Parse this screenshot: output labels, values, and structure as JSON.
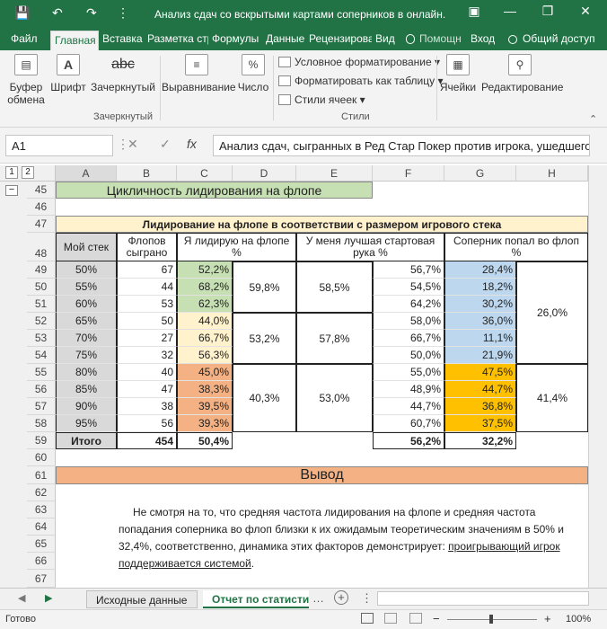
{
  "window": {
    "title": "Анализ сдач со вскрытыми картами соперников в онлайн...",
    "min": "—",
    "restore": "❐",
    "close": "✕",
    "qa_save": "💾",
    "qa_undo": "↶",
    "qa_redo": "↷",
    "qa_more": "⋮",
    "ribbon_options": "▣"
  },
  "tabs": [
    "Файл",
    "Главная",
    "Вставка",
    "Разметка стр",
    "Формулы",
    "Данные",
    "Рецензирова",
    "Вид",
    "Помощн",
    "Вход",
    "Общий доступ"
  ],
  "ribbon": {
    "clipboard": "Буфер обмена",
    "font": "Шрифт",
    "strike": "abc",
    "strike_label": "Зачеркнутый",
    "alignment": "Выравнивание",
    "number": "Число",
    "cond_format": "Условное форматирование",
    "format_table": "Форматировать как таблицу",
    "cell_styles": "Стили ячеек",
    "cells": "Ячейки",
    "editing": "Редактирование",
    "group_strike": "Зачеркнутый",
    "group_styles": "Стили"
  },
  "formula_bar": {
    "name_box": "A1",
    "fx": "fx",
    "formula": "Анализ сдач, сыгранных в Ред Стар Покер против игрока, ушедшего"
  },
  "columns": [
    "A",
    "B",
    "C",
    "D",
    "E",
    "F",
    "G",
    "H"
  ],
  "outline_levels": [
    "1",
    "2"
  ],
  "rows": [
    "45",
    "46",
    "47",
    "48",
    "49",
    "50",
    "51",
    "52",
    "53",
    "54",
    "55",
    "56",
    "57",
    "58",
    "59",
    "60",
    "61",
    "62",
    "63",
    "64",
    "65",
    "66",
    "67"
  ],
  "sheet": {
    "section_title": "Цикличность лидирования на флопе",
    "table_title": "Лидирование на флопе в соответствии с размером игрового стека",
    "headers": [
      "Мой стек",
      "Флопов сыграно",
      "Я лидирую на флопе %",
      "У меня лучшая стартовая рука %",
      "Соперник попал во флоп %"
    ],
    "data_rows": [
      [
        "50%",
        "67",
        "52,2%",
        "56,7%",
        "28,4%"
      ],
      [
        "55%",
        "44",
        "68,2%",
        "54,5%",
        "18,2%"
      ],
      [
        "60%",
        "53",
        "62,3%",
        "64,2%",
        "30,2%"
      ],
      [
        "65%",
        "50",
        "44,0%",
        "58,0%",
        "36,0%"
      ],
      [
        "70%",
        "27",
        "66,7%",
        "66,7%",
        "11,1%"
      ],
      [
        "75%",
        "32",
        "56,3%",
        "50,0%",
        "21,9%"
      ],
      [
        "80%",
        "40",
        "45,0%",
        "55,0%",
        "47,5%"
      ],
      [
        "85%",
        "47",
        "38,3%",
        "48,9%",
        "44,7%"
      ],
      [
        "90%",
        "38",
        "39,5%",
        "44,7%",
        "36,8%"
      ],
      [
        "95%",
        "56",
        "39,3%",
        "60,7%",
        "37,5%"
      ]
    ],
    "group_lead": [
      "59,8%",
      "53,2%",
      "40,3%"
    ],
    "group_best": [
      "58,5%",
      "57,8%",
      "53,0%"
    ],
    "group_opp": [
      "26,0%",
      "41,4%"
    ],
    "total_label": "Итого",
    "total_flops": "454",
    "total_lead": "50,4%",
    "total_best": "56,2%",
    "total_opp": "32,2%",
    "conclusion_title": "Вывод",
    "conclusion_l1": "Не смотря на то, что средняя частота лидирования на флопе и средняя частота",
    "conclusion_l2": "попадания соперника во флоп близки к их ожидамым теоретическим значениям в 50% и",
    "conclusion_l3a": "32,4%, соответственно, динамика этих факторов демонстрирует: ",
    "conclusion_l3b": "проигрывающий игрок",
    "conclusion_l4a": "поддерживается системой",
    "conclusion_l4b": "."
  },
  "sheet_tabs": [
    "Исходные данные",
    "Отчет по статисти"
  ],
  "status": {
    "ready": "Готово",
    "zoom": "100%"
  },
  "colors": {
    "green_bar": "#217346",
    "title_green": "#c6e0b4",
    "yellow": "#fff2cc",
    "lightgreen": "#c6e0b4",
    "lightyellow": "#fff2cc",
    "salmon": "#f4b183",
    "blue": "#bdd7ee",
    "orange": "#ffc000",
    "gray": "#d9d9d9"
  }
}
